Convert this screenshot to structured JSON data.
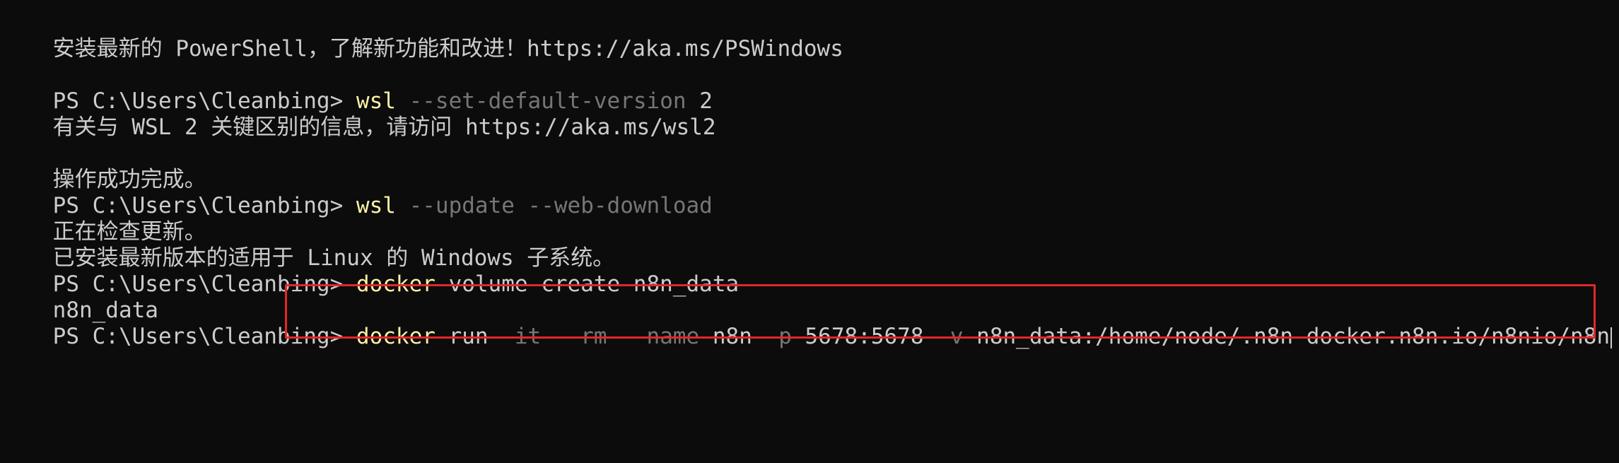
{
  "terminal": {
    "lines": {
      "l0": "安装最新的 PowerShell，了解新功能和改进！https://aka.ms/PSWindows",
      "l2_prompt": "PS C:\\Users\\Cleanbing> ",
      "l2_cmd": "wsl",
      "l2_param": " --set-default-version",
      "l2_arg": " 2",
      "l3": "有关与 WSL 2 关键区别的信息，请访问 https://aka.ms/wsl2",
      "l5": "操作成功完成。",
      "l6_prompt": "PS C:\\Users\\Cleanbing> ",
      "l6_cmd": "wsl",
      "l6_param": " --update --web-download",
      "l7": "正在检查更新。",
      "l8": "已安装最新版本的适用于 Linux 的 Windows 子系统。",
      "l9_prompt": "PS C:\\Users\\Cleanbing> ",
      "l9_cmd": "docker",
      "l9_arg": " volume create n8n_data",
      "l10": "n8n_data",
      "l11_prompt": "PS C:\\Users\\Cleanbing> ",
      "l11_cmd": "docker",
      "l11_a1": " run ",
      "l11_p1": "-it --rm --name",
      "l11_a2": " n8n ",
      "l11_p2": "-p",
      "l11_a3": " 5678:5678 ",
      "l11_p3": "-v",
      "l11_a4": " n8n_data:/home/node/.n8n docker.n8n.io/n8nio/n8n"
    }
  },
  "colors": {
    "background": "#0c0c0c",
    "text": "#cccccc",
    "command": "#f9f1a5",
    "parameter": "#767676",
    "highlight": "#e5262b"
  }
}
